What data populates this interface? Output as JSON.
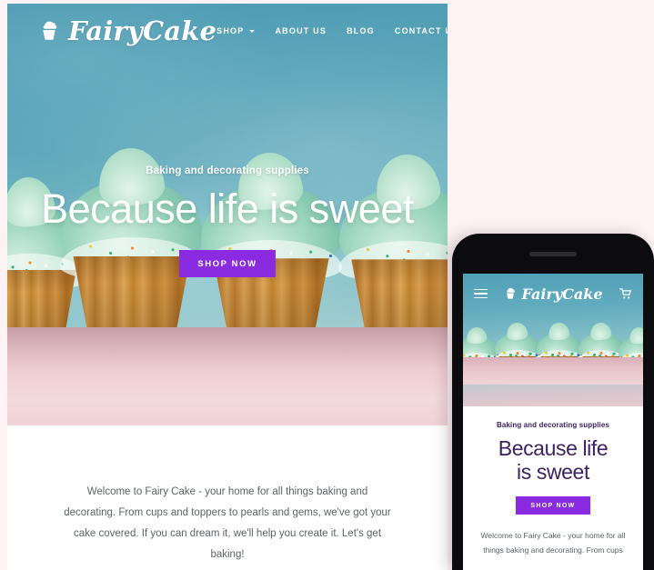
{
  "site": {
    "brand_name": "FairyCake",
    "brand_icon": "cupcake-icon"
  },
  "desktop": {
    "nav": {
      "items": [
        {
          "label": "SHOP",
          "has_dropdown": true
        },
        {
          "label": "ABOUT US",
          "has_dropdown": false
        },
        {
          "label": "BLOG",
          "has_dropdown": false
        },
        {
          "label": "CONTACT US",
          "has_dropdown": false
        }
      ],
      "icons": [
        {
          "name": "search-icon"
        },
        {
          "name": "cart-icon"
        }
      ]
    },
    "hero": {
      "kicker": "Baking and decorating supplies",
      "title": "Because life is sweet",
      "cta_label": "SHOP NOW",
      "image_alt": "Row of cupcakes with mint frosting and rainbow sprinkles"
    },
    "body": {
      "paragraph": "Welcome to Fairy Cake - your home for all things baking and decorating. From cups and toppers to pearls and gems, we've got your cake covered. If you can dream it, we'll help you create it. Let's get baking!"
    }
  },
  "mobile": {
    "nav": {
      "menu_icon": "hamburger-icon",
      "cart_icon": "cart-icon"
    },
    "hero": {
      "kicker": "Baking and decorating supplies",
      "title_line1": "Because life",
      "title_line2": "is sweet",
      "cta_label": "SHOP NOW"
    },
    "body": {
      "paragraph": "Welcome to Fairy Cake - your home for all things baking and decorating. From cups"
    }
  },
  "colors": {
    "accent_purple": "#8a2be2",
    "heading_purple": "#3b2263",
    "hero_teal_top": "#4e9cb4",
    "hero_teal_bottom": "#8ec6cb",
    "table_pink": "#eecdd2",
    "page_background": "#fdf2f4",
    "body_text": "#5d6368"
  }
}
